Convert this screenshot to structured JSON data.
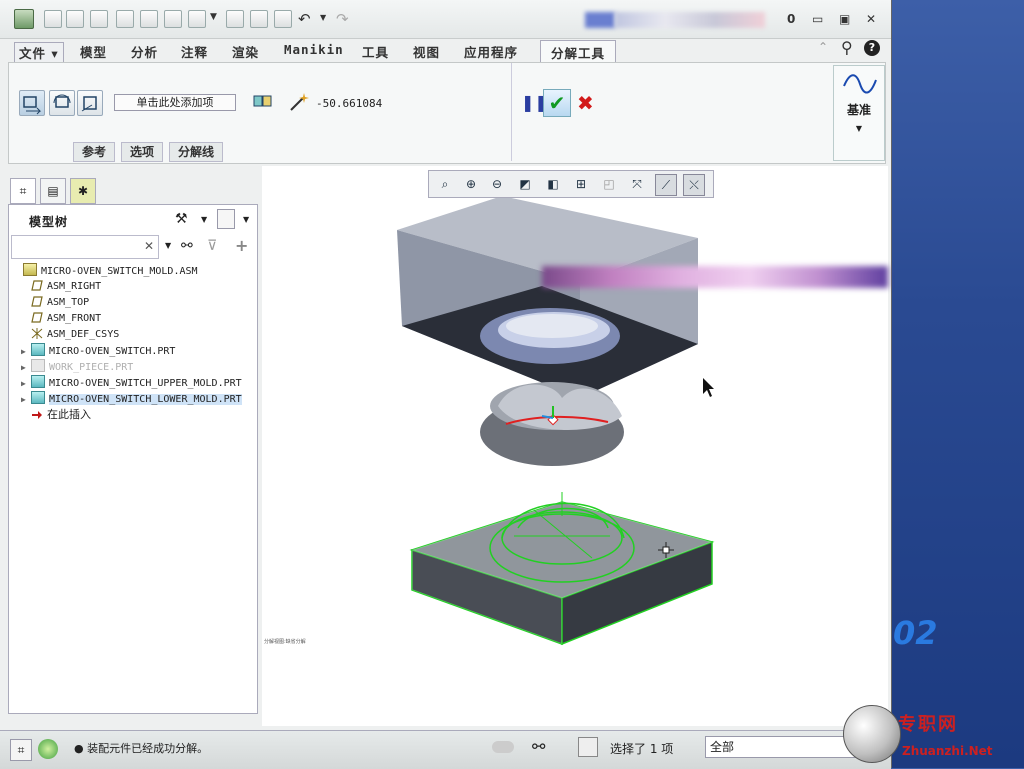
{
  "titlebar": {
    "counter": "0",
    "minimize_glyph": "▭",
    "maximize_glyph": "▣",
    "close_glyph": "✕"
  },
  "ribbon_tabs": [
    "文件 ▾",
    "模型",
    "分析",
    "注释",
    "渲染",
    "Manikin",
    "工具",
    "视图",
    "应用程序",
    "分解工具"
  ],
  "ribbon": {
    "add_item_label": "单击此处添加项",
    "value": "-50.661084",
    "subtabs": [
      "参考",
      "选项",
      "分解线"
    ],
    "datum_label": "基准"
  },
  "left_panel": {
    "header_label": "模型树",
    "search_placeholder": "",
    "clear_glyph": "✕"
  },
  "tree": [
    {
      "label": "MICRO-OVEN_SWITCH_MOLD.ASM",
      "icon": "asm",
      "depth": 0,
      "arrow": ""
    },
    {
      "label": "ASM_RIGHT",
      "icon": "plane",
      "depth": 1,
      "arrow": ""
    },
    {
      "label": "ASM_TOP",
      "icon": "plane",
      "depth": 1,
      "arrow": ""
    },
    {
      "label": "ASM_FRONT",
      "icon": "plane",
      "depth": 1,
      "arrow": ""
    },
    {
      "label": "ASM_DEF_CSYS",
      "icon": "csys",
      "depth": 1,
      "arrow": ""
    },
    {
      "label": "MICRO-OVEN_SWITCH.PRT",
      "icon": "part",
      "depth": 1,
      "arrow": "▶"
    },
    {
      "label": "WORK_PIECE.PRT",
      "icon": "partg",
      "depth": 1,
      "arrow": "▶"
    },
    {
      "label": "MICRO-OVEN_SWITCH_UPPER_MOLD.PRT",
      "icon": "part",
      "depth": 1,
      "arrow": "▶"
    },
    {
      "label": "MICRO-OVEN_SWITCH_LOWER_MOLD.PRT",
      "icon": "part",
      "depth": 1,
      "arrow": "▶"
    },
    {
      "label": "在此插入",
      "icon": "insert",
      "depth": 1,
      "arrow": ""
    }
  ],
  "viewport": {
    "tiny_label": "分解视图:缺省分解"
  },
  "status": {
    "message": "● 装配元件已经成功分解。",
    "selected": "选择了 1 项",
    "filter_value": "全部"
  },
  "watermark": {
    "number": "02",
    "site_cn": "专职网",
    "site_en": "Zhuanzhi.Net"
  },
  "colors": {
    "accent_green": "#119922",
    "cancel_red": "#d21a1a",
    "selection_green": "#22d022",
    "desktop_blue": "#2a4a92"
  }
}
